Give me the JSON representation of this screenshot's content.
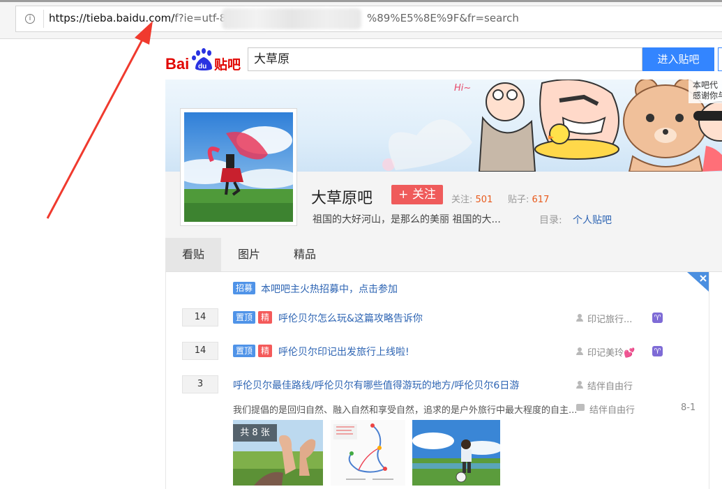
{
  "browser": {
    "url_host": "https://tieba.baidu.com/",
    "url_path_start": "f?ie=utf-8&",
    "url_path_end": "%89%E5%8E%9F&fr=search",
    "info_icon": "i"
  },
  "header": {
    "logo_text_bai": "Bai",
    "logo_text_du": "du",
    "logo_text_tieba": "贴吧",
    "search_value": "大草原",
    "enter_button": "进入贴吧",
    "banner_text_1": "本吧代",
    "banner_text_2": "感谢你与",
    "banner_hi": "Hi~"
  },
  "forum": {
    "name": "大草原吧",
    "follow_button": "+ 关注",
    "follow_label": "关注:",
    "follow_count": "501",
    "posts_label": "贴子:",
    "posts_count": "617",
    "slogan": "祖国的大好河山，是那么的美丽 祖国的大...",
    "dir_label": "目录:",
    "dir_link": "个人贴吧"
  },
  "tabs": [
    {
      "label": "看贴"
    },
    {
      "label": "图片"
    },
    {
      "label": "精品"
    }
  ],
  "threads": [
    {
      "badges": [
        "招募"
      ],
      "title": "本吧吧主火热招募中，点击参加"
    },
    {
      "reply": "14",
      "badges": [
        "置顶",
        "精"
      ],
      "title": "呼伦贝尔怎么玩&这篇攻略告诉你",
      "author": "印记旅行...",
      "level_icon": "♈"
    },
    {
      "reply": "14",
      "badges": [
        "置顶",
        "精"
      ],
      "title": "呼伦贝尔印记出发旅行上线啦!",
      "author": "印记美玲💕",
      "level_icon": "♈"
    },
    {
      "reply": "3",
      "title": "呼伦贝尔最佳路线/呼伦贝尔有哪些值得游玩的地方/呼伦贝尔6日游",
      "author": "结伴自由行",
      "abstract": "我们提倡的是回归自然、融入自然和享受自然，追求的是户外旅行中最大程度的自主...",
      "last_author": "结伴自由行",
      "last_time": "8-1",
      "image_count": "共 8 张"
    }
  ],
  "colors": {
    "accent_blue": "#3385ff",
    "link_blue": "#2d64b3",
    "follow_red": "#ef5b5b",
    "arrow_red": "#f03a2e"
  }
}
